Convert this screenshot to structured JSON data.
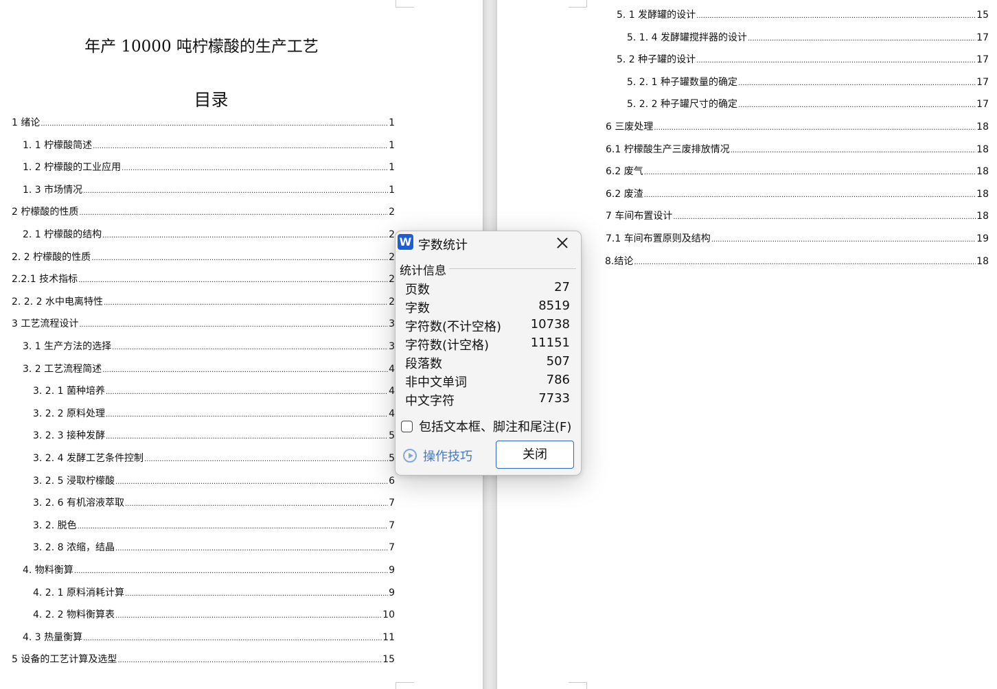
{
  "document": {
    "title": "年产 10000 吨柠檬酸的生产工艺",
    "toc_heading": "目录",
    "toc_left": [
      {
        "label": "1  绪论",
        "page": "1"
      },
      {
        "label": "1. 1  柠檬酸简述",
        "page": "1"
      },
      {
        "label": "1. 2  柠檬酸的工业应用",
        "page": "1"
      },
      {
        "label": "1. 3 市场情况",
        "page": "1"
      },
      {
        "label": "2  柠檬酸的性质",
        "page": "2"
      },
      {
        "label": "2. 1  柠檬酸的结构",
        "page": "2"
      },
      {
        "label": "2. 2  柠檬酸的性质",
        "page": "2"
      },
      {
        "label": "2.2.1 技术指标",
        "page": "2"
      },
      {
        "label": "2. 2. 2 水中电离特性",
        "page": "2"
      },
      {
        "label": "3  工艺流程设计",
        "page": "3"
      },
      {
        "label": "3. 1  生产方法的选择",
        "page": "3"
      },
      {
        "label": "3. 2  工艺流程简述",
        "page": "4"
      },
      {
        "label": "3. 2. 1  菌种培养",
        "page": "4"
      },
      {
        "label": "3. 2. 2  原料处理",
        "page": "4"
      },
      {
        "label": "3. 2. 3  接种发酵",
        "page": "5"
      },
      {
        "label": "3. 2. 4  发酵工艺条件控制",
        "page": "5"
      },
      {
        "label": "3. 2. 5  浸取柠檬酸",
        "page": "6"
      },
      {
        "label": "3. 2. 6  有机溶液萃取",
        "page": "7"
      },
      {
        "label": "3. 2. 脱色",
        "page": "7"
      },
      {
        "label": "3. 2. 8 浓缩，结晶",
        "page": "7"
      },
      {
        "label": "4. 物料衡算",
        "page": "9"
      },
      {
        "label": "4. 2. 1  原料消耗计算",
        "page": "9"
      },
      {
        "label": "4. 2. 2  物料衡算表",
        "page": "10"
      },
      {
        "label": "4. 3  热量衡算",
        "page": "11"
      },
      {
        "label": "5  设备的工艺计算及选型",
        "page": "15"
      }
    ],
    "toc_right": [
      {
        "label": "5. 1  发酵罐的设计",
        "page": "15"
      },
      {
        "label": "5. 1. 4  发酵罐搅拌器的设计",
        "page": "17"
      },
      {
        "label": "5. 2  种子罐的设计",
        "page": "17"
      },
      {
        "label": "5. 2. 1  种子罐数量的确定",
        "page": "17"
      },
      {
        "label": "5. 2. 2  种子罐尺寸的确定",
        "page": "17"
      },
      {
        "label": "6  三废处理",
        "page": "18"
      },
      {
        "label": "6.1  柠檬酸生产三废排放情况",
        "page": "18"
      },
      {
        "label": "6.2 废气",
        "page": "18"
      },
      {
        "label": "6.2 废渣",
        "page": "18"
      },
      {
        "label": "7  车间布置设计",
        "page": "18"
      },
      {
        "label": "7.1 车间布置原则及结构",
        "page": "19"
      },
      {
        "label": "8.结论",
        "page": "18"
      }
    ]
  },
  "dialog": {
    "app_icon": "W",
    "title": "字数统计",
    "close_icon": "close-icon",
    "group_label": "统计信息",
    "stats": [
      {
        "label": "页数",
        "value": "27"
      },
      {
        "label": "字数",
        "value": "8519"
      },
      {
        "label": "字符数(不计空格)",
        "value": "10738"
      },
      {
        "label": "字符数(计空格)",
        "value": "11151"
      },
      {
        "label": "段落数",
        "value": "507"
      },
      {
        "label": "非中文单词",
        "value": "786"
      },
      {
        "label": "中文字符",
        "value": "7733"
      }
    ],
    "checkbox_label": "包括文本框、脚注和尾注(F)",
    "checkbox_checked": false,
    "tips_label": "操作技巧",
    "close_button": "关闭",
    "colors": {
      "accent": "#2b66c9",
      "link": "#3b7ad8",
      "app_icon_bg": "#1c5fd4"
    }
  }
}
